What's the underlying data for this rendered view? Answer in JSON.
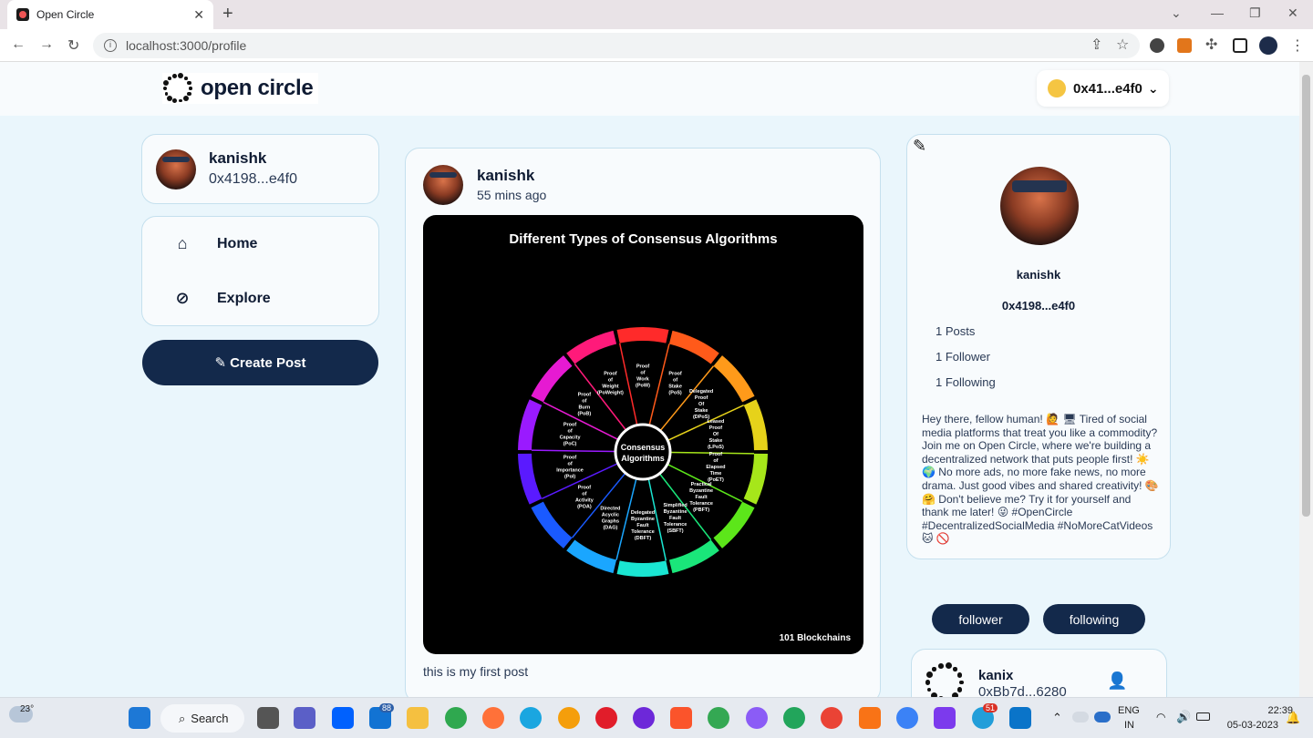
{
  "browser": {
    "tab_title": "Open Circle",
    "tab_close": "✕",
    "new_tab": "+",
    "url": "localhost:3000/profile"
  },
  "header": {
    "logo_text": "open circle",
    "wallet_label": "0x41...e4f0",
    "wallet_chevron": "⌄"
  },
  "user_card": {
    "name": "kanishk",
    "address": "0x4198...e4f0"
  },
  "nav": {
    "items": [
      {
        "label": "Home",
        "icon": "home-icon"
      },
      {
        "label": "Explore",
        "icon": "compass-icon"
      }
    ]
  },
  "create_post": {
    "label": "Create Post",
    "icon": "edit-icon"
  },
  "post": {
    "author": "kanishk",
    "time": "55 mins ago",
    "image_title": "Different Types of Consensus Algorithms",
    "image_center": "Consensus Algorithms",
    "image_brand": "101 Blockchains",
    "segments": [
      "Proof of Work (PoW)",
      "Proof of Stake (PoS)",
      "Delegated Proof Of Stake (DPoS)",
      "Leased Proof Of Stake (LPoS)",
      "Proof of Elapsed Time (PoET)",
      "Practical Byzantine Fault Tolerance (PBFT)",
      "Simplified Byzantine Fault Tolerance (SBFT)",
      "Delegated Byzantine Fault Tolerance (DBFT)",
      "Directed Acyclic Graphs (DAG)",
      "Proof of Activity (POA)",
      "Proof of Importance (PoI)",
      "Proof of Capacity (PoC)",
      "Proof of Burn (PoB)",
      "Proof of Weight (PoWeight)"
    ],
    "caption": "this is my first post"
  },
  "profile": {
    "edit_icon": "edit-icon",
    "name": "kanishk",
    "address": "0x4198...e4f0",
    "posts": "1 Posts",
    "followers": "1 Follower",
    "following": "1 Following",
    "bio": "Hey there, fellow human! 🙋 🖥 Tired of social media platforms that treat you like a commodity? Join me on Open Circle, where we're building a decentralized network that puts people first! ☀️ 🌍 No more ads, no more fake news, no more drama. Just good vibes and shared creativity! 🎨 🤗 Don't believe me? Try it for yourself and thank me later! 😜 #OpenCircle #DecentralizedSocialMedia #NoMoreCatVideos 🐱 🚫"
  },
  "tabs": {
    "follower": "follower",
    "following": "following"
  },
  "follow_item": {
    "name": "kanix",
    "address": "0xBb7d...6280"
  },
  "taskbar": {
    "weather": "23°",
    "search": "Search",
    "mail_badge": "88",
    "telegram_badge": "51",
    "lang_top": "ENG",
    "lang_bottom": "IN",
    "time": "22:39",
    "date": "05-03-2023"
  },
  "colors": {
    "page_bg": "#eaf6fc",
    "primary": "#13294b",
    "card_border": "#c5e0ee"
  }
}
